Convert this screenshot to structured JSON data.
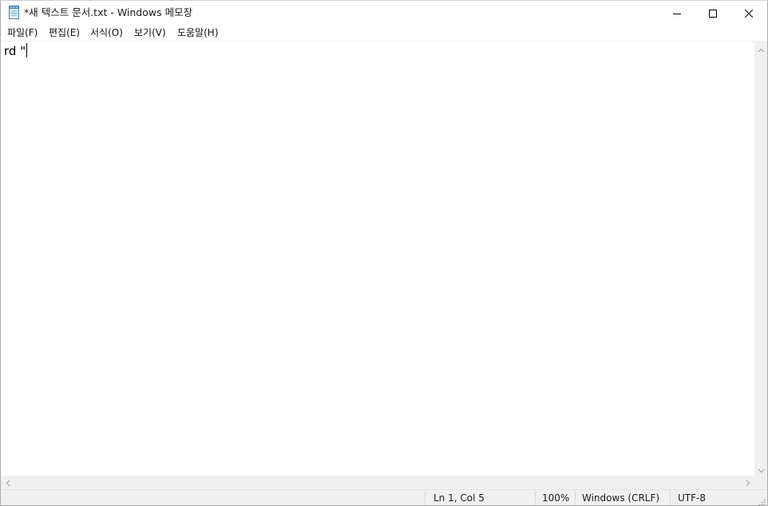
{
  "window": {
    "title": "*새 텍스트 문서.txt - Windows 메모장",
    "app_icon": "notepad-icon"
  },
  "caption_buttons": {
    "minimize_icon": "minimize-icon",
    "maximize_icon": "maximize-icon",
    "close_icon": "close-icon"
  },
  "menu": [
    {
      "label": "파일(F)"
    },
    {
      "label": "편집(E)"
    },
    {
      "label": "서식(O)"
    },
    {
      "label": "보기(V)"
    },
    {
      "label": "도움말(H)"
    }
  ],
  "editor": {
    "content": "rd \""
  },
  "statusbar": {
    "position": "Ln 1, Col 5",
    "zoom": "100%",
    "line_ending": "Windows (CRLF)",
    "encoding": "UTF-8"
  }
}
